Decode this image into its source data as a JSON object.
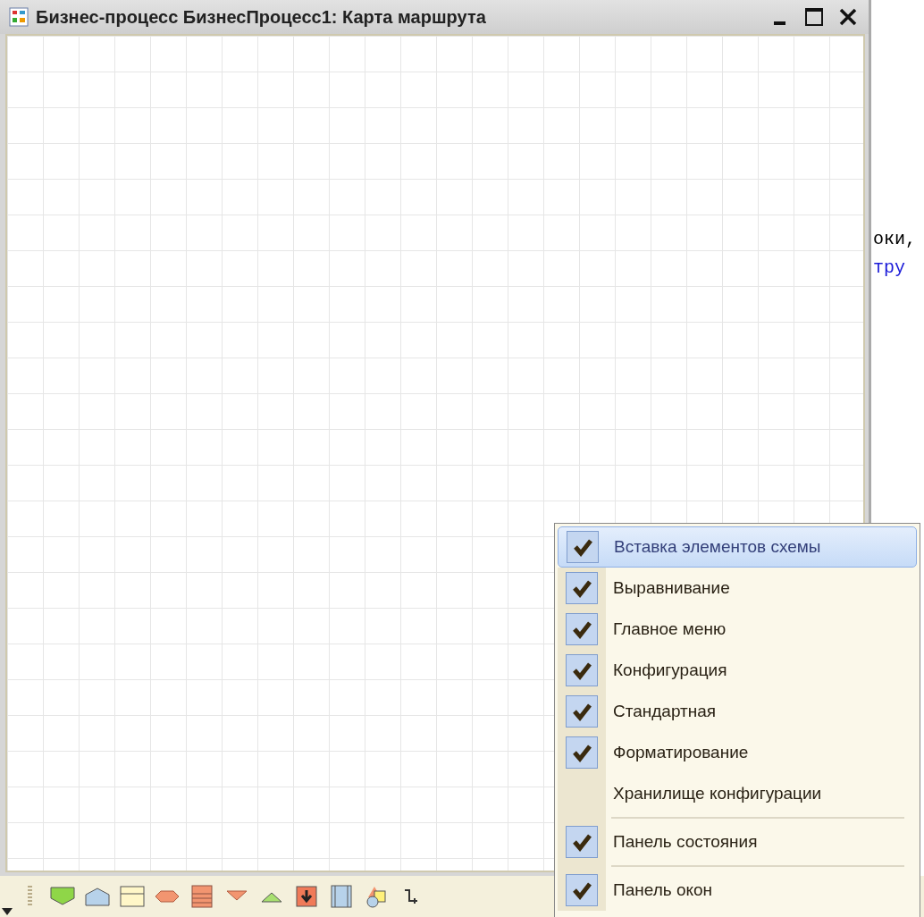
{
  "window": {
    "title": "Бизнес-процесс БизнесПроцесс1: Карта маршрута"
  },
  "editor": {
    "lines": [
      {
        "text": "оки,",
        "kind": "plain"
      },
      {
        "text": "тру",
        "kind": "keyword"
      }
    ]
  },
  "context_menu": {
    "items": [
      {
        "kind": "item",
        "label": "Вставка элементов схемы",
        "checked": true,
        "selected": true
      },
      {
        "kind": "item",
        "label": "Выравнивание",
        "checked": true,
        "selected": false
      },
      {
        "kind": "item",
        "label": "Главное меню",
        "checked": true,
        "selected": false
      },
      {
        "kind": "item",
        "label": "Конфигурация",
        "checked": true,
        "selected": false
      },
      {
        "kind": "item",
        "label": "Стандартная",
        "checked": true,
        "selected": false
      },
      {
        "kind": "item",
        "label": "Форматирование",
        "checked": true,
        "selected": false
      },
      {
        "kind": "item",
        "label": "Хранилище конфигурации",
        "checked": false,
        "selected": false
      },
      {
        "kind": "separator"
      },
      {
        "kind": "item",
        "label": "Панель состояния",
        "checked": true,
        "selected": false
      },
      {
        "kind": "separator"
      },
      {
        "kind": "item",
        "label": "Панель окон",
        "checked": true,
        "selected": false
      }
    ]
  }
}
